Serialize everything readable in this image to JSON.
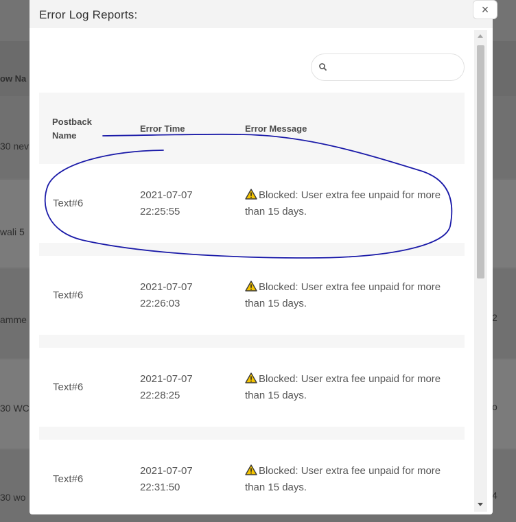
{
  "background": {
    "labels": [
      "ow Na",
      "30 nev",
      "wali 5",
      "amme",
      "30 WC",
      "30 wo"
    ],
    "right_labels": [
      "2",
      "o",
      "4"
    ]
  },
  "modal": {
    "title": "Error Log Reports:",
    "close_label": "×",
    "search": {
      "placeholder": "",
      "value": ""
    },
    "table": {
      "headers": {
        "name_line1": "Postback",
        "name_line2": "Name",
        "time": "Error Time",
        "message": "Error Message"
      },
      "rows": [
        {
          "name": "Text#6",
          "date": "2021-07-07",
          "time": "22:25:55",
          "message": "Blocked: User extra fee unpaid for more than 15 days."
        },
        {
          "name": "Text#6",
          "date": "2021-07-07",
          "time": "22:26:03",
          "message": "Blocked: User extra fee unpaid for more than 15 days."
        },
        {
          "name": "Text#6",
          "date": "2021-07-07",
          "time": "22:28:25",
          "message": "Blocked: User extra fee unpaid for more than 15 days."
        },
        {
          "name": "Text#6",
          "date": "2021-07-07",
          "time": "22:31:50",
          "message": "Blocked: User extra fee unpaid for more than 15 days."
        }
      ]
    }
  },
  "colors": {
    "overlay": "#737373",
    "modal_bg": "#ffffff",
    "header_bg": "#f3f3f3",
    "annotation_ink": "#1a1aa8",
    "warning": "#f5c400"
  },
  "icons": {
    "search": "search-icon",
    "warning": "warning-icon",
    "close": "close-icon"
  }
}
